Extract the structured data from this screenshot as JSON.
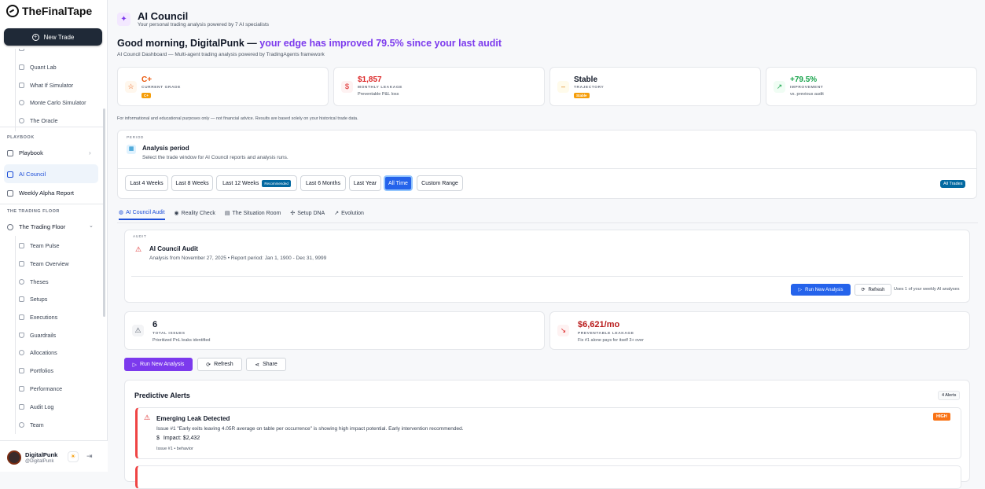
{
  "app": {
    "brand": "TheFinalTape",
    "new_trade": "New Trade"
  },
  "sidebar": {
    "tools": [
      "Quant Lab",
      "What If Simulator",
      "Monte Carlo Simulator",
      "The Oracle"
    ],
    "playbook_section": "PLAYBOOK",
    "playbook": "Playbook",
    "ai_council": "AI Council",
    "weekly_alpha": "Weekly Alpha Report",
    "floor_section": "THE TRADING FLOOR",
    "trading_floor": "The Trading Floor",
    "floor_items": [
      "Team Pulse",
      "Team Overview",
      "Theses",
      "Setups",
      "Executions",
      "Guardrails",
      "Allocations",
      "Portfolios",
      "Performance",
      "Audit Log",
      "Team"
    ]
  },
  "user": {
    "name": "DigitalPunk",
    "handle": "@DigitalPunk"
  },
  "header": {
    "title": "AI Council",
    "subtitle": "Your personal trading analysis powered by 7 AI specialists"
  },
  "greeting": {
    "lead": "Good morning, DigitalPunk — ",
    "highlight": "your edge has improved 79.5% since your last audit",
    "sub": "AI Council Dashboard — Multi-agent trading analysis powered by TradingAgents framework"
  },
  "kpis": [
    {
      "value": "C+",
      "label": "CURRENT GRADE",
      "badge": "C+",
      "color": "#ea580c"
    },
    {
      "value": "$1,857",
      "label": "MONTHLY LEAKAGE",
      "sub": "Preventable P&L loss",
      "color": "#dc2626"
    },
    {
      "value": "Stable",
      "label": "TRAJECTORY",
      "badge": "Stable",
      "color": "#111827"
    },
    {
      "value": "+79.5%",
      "label": "IMPROVEMENT",
      "sub": "vs. previous audit",
      "color": "#16a34a"
    }
  ],
  "disclaimer": "For informational and educational purposes only — not financial advice. Results are based solely on your historical trade data.",
  "period": {
    "label": "PERIOD",
    "title": "Analysis period",
    "sub": "Select the trade window for AI Council reports and analysis runs.",
    "options": [
      "Last 4 Weeks",
      "Last 8 Weeks",
      "Last 12 Weeks",
      "Last 6 Months",
      "Last Year",
      "All Time",
      "Custom Range"
    ],
    "recommended": "Recommended",
    "selected": "All Time",
    "all_trades": "All Trades"
  },
  "tabs": [
    "AI Council Audit",
    "Reality Check",
    "The Situation Room",
    "Setup DNA",
    "Evolution"
  ],
  "audit": {
    "label": "AUDIT",
    "title": "AI Council Audit",
    "sub": "Analysis from November 27, 2025 • Report period: Jan 1, 1900 - Dec 31, 9999",
    "run": "Run New Analysis",
    "refresh": "Refresh",
    "usage": "Uses 1 of your weekly AI analyses"
  },
  "issues": {
    "count": "6",
    "label": "TOTAL ISSUES",
    "sub": "Prioritized PnL leaks identified"
  },
  "leak": {
    "value": "$6,621/mo",
    "label": "PREVENTABLE LEAKAGE",
    "sub": "Fix #1 alone pays for itself 3+ over"
  },
  "actions": {
    "run": "Run New Analysis",
    "refresh": "Refresh",
    "share": "Share"
  },
  "alerts": {
    "title": "Predictive Alerts",
    "count": "4 Alerts",
    "items": [
      {
        "title": "Emerging Leak Detected",
        "body": "Issue #1 \"Early exits leaving 4.05R average on table per occurrence\" is showing high impact potential. Early intervention recommended.",
        "impact": "Impact: $2,432",
        "meta": "Issue #1 • behavior",
        "severity": "HIGH"
      }
    ]
  }
}
